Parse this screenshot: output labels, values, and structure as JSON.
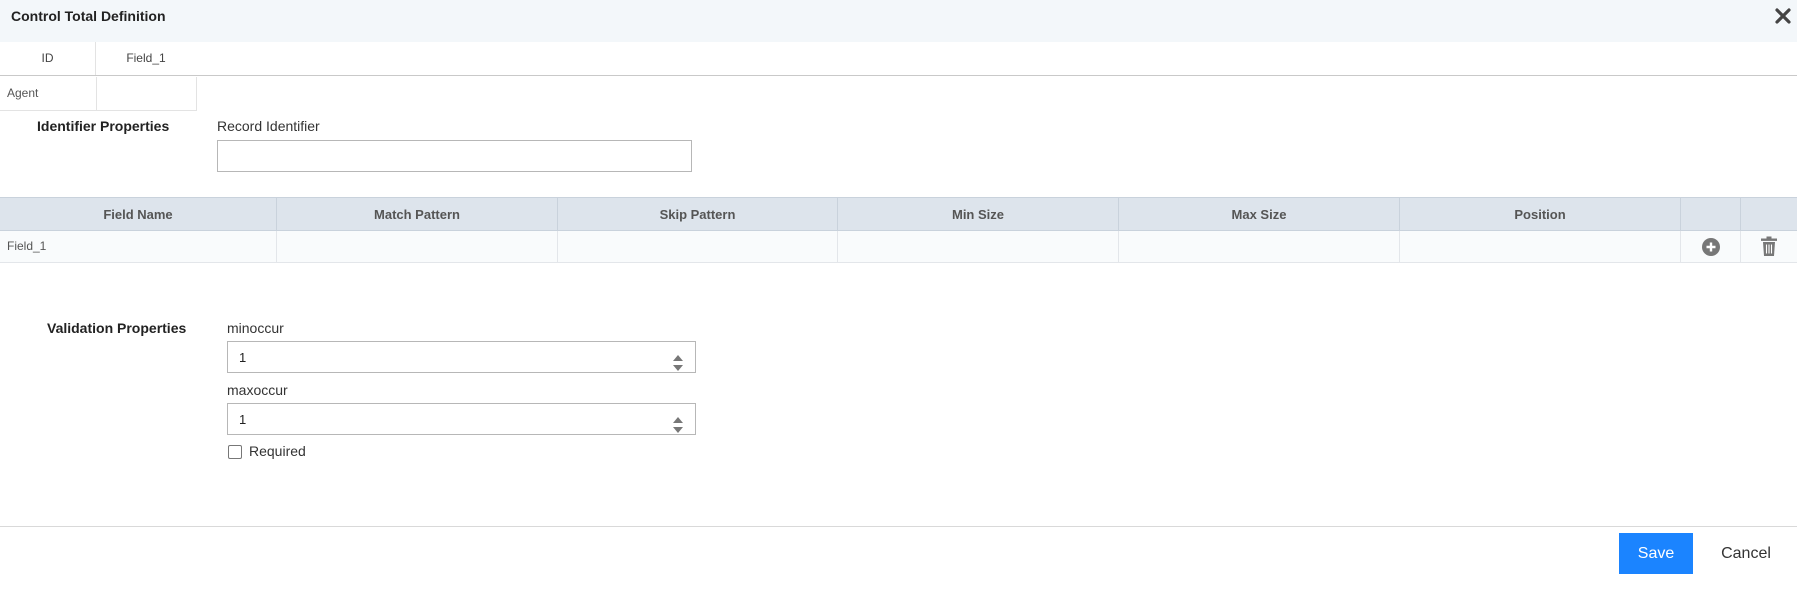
{
  "dialog": {
    "title": "Control Total Definition"
  },
  "id_row": {
    "label": "ID",
    "value": "Field_1"
  },
  "agent": {
    "label": "Agent",
    "value": ""
  },
  "identifier": {
    "section_label": "Identifier Properties",
    "field_label": "Record Identifier",
    "value": ""
  },
  "table": {
    "headers": [
      "Field Name",
      "Match Pattern",
      "Skip Pattern",
      "Min Size",
      "Max Size",
      "Position"
    ],
    "rows": [
      {
        "field_name": "Field_1",
        "match_pattern": "",
        "skip_pattern": "",
        "min_size": "",
        "max_size": "",
        "position": ""
      }
    ],
    "row_icons": [
      "plus-circle-icon",
      "trash-icon"
    ]
  },
  "validation": {
    "section_label": "Validation Properties",
    "minoccur_label": "minoccur",
    "minoccur_value": "1",
    "maxoccur_label": "maxoccur",
    "maxoccur_value": "1",
    "required_label": "Required",
    "required_checked": false
  },
  "footer": {
    "save_label": "Save",
    "cancel_label": "Cancel"
  },
  "colors": {
    "primary": "#1b84ff",
    "header_bg": "#dde4ec",
    "title_bg": "#f3f7fa"
  }
}
